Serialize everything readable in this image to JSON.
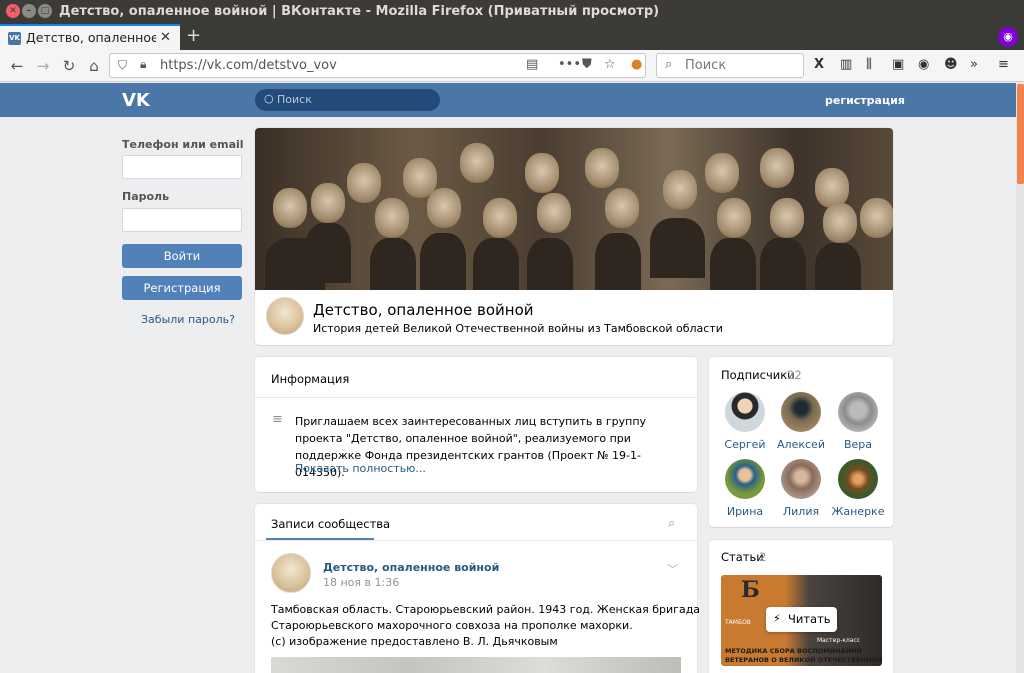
{
  "window": {
    "title": "Детство, опаленное войной | ВКонтакте - Mozilla Firefox (Приватный просмотр)"
  },
  "tab": {
    "label": "Детство, опаленное во",
    "favicon_text": "VK"
  },
  "nav": {
    "url": "https://vk.com/detstvo_vov",
    "search_placeholder": "Поиск"
  },
  "vk_header": {
    "logo": "VK",
    "search_placeholder": "Поиск",
    "register_link": "регистрация",
    "brand_color": "#4a76a8"
  },
  "login": {
    "phone_label": "Телефон или email",
    "password_label": "Пароль",
    "login_button": "Войти",
    "register_button": "Регистрация",
    "forgot_link": "Забыли пароль?"
  },
  "group": {
    "name": "Детство, опаленное войной",
    "status": "История детей Великой Отечественной войны из Тамбовской области"
  },
  "info": {
    "heading": "Информация",
    "text": "Приглашаем всех заинтересованных лиц вступить в группу проекта \"Детство, опаленное войной\", реализуемого при поддержке Фонда президентских грантов (Проект № 19-1-014350).",
    "show_more": "Показать полностью..."
  },
  "wall": {
    "tab_label": "Записи сообщества",
    "post": {
      "author": "Детство, опаленное войной",
      "date": "18 ноя в 1:36",
      "text_line1": "Тамбовская область. Староюрьевский район. 1943 год. Женская бригада",
      "text_line2": "Староюрьевского махорочного совхоза на прополке махорки.",
      "text_line3": "(с) изображение предоставлено В. Л. Дьячковым"
    }
  },
  "subscribers": {
    "heading": "Подписчики",
    "count": "22",
    "people": [
      "Сергей",
      "Алексей",
      "Вера",
      "Ирина",
      "Лилия",
      "Жанерке"
    ]
  },
  "articles": {
    "heading": "Статьи",
    "count": "2",
    "read_button": "Читать",
    "thumb_line1": "МЕТОДИКА СБОРА ВОСПОМИНАНИЙ",
    "thumb_line2": "ВЕТЕРАНОВ О ВЕЛИКОЙ ОТЕЧЕСТВЕННОЙ",
    "thumb_badge": "Мастер-класс",
    "thumb_city": "ТАМБОВ"
  }
}
